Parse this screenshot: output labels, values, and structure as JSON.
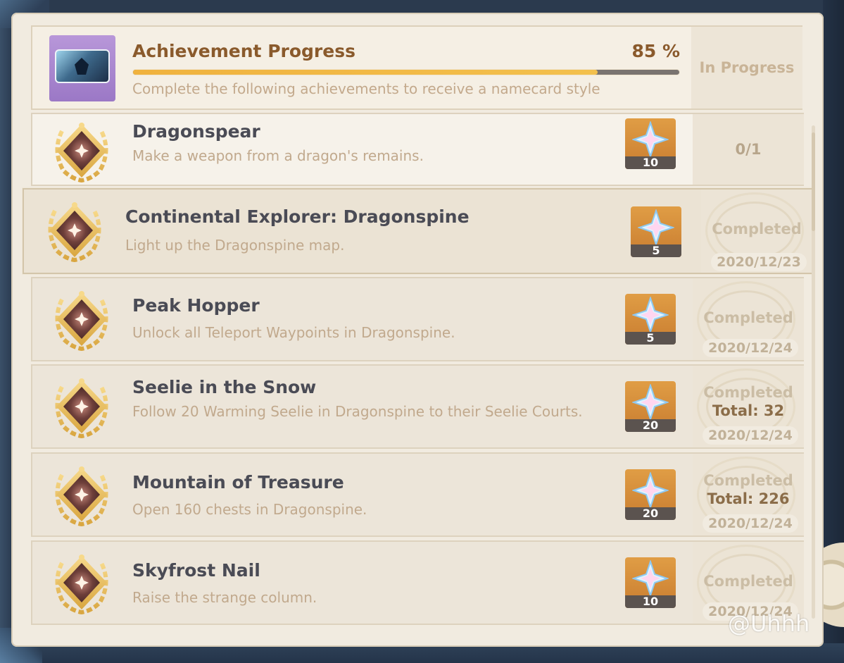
{
  "header": {
    "title": "Achievement Progress",
    "percent_label": "85 %",
    "progress": 0.85,
    "description": "Complete the following achievements to receive a namecard style",
    "status": "In Progress"
  },
  "achievements": [
    {
      "title": "Dragonspear",
      "description": "Make a weapon from a dragon's remains.",
      "reward": "10",
      "status": "0/1"
    },
    {
      "title": "Continental Explorer: Dragonspine",
      "description": "Light up the Dragonspine map.",
      "reward": "5",
      "status": "Completed",
      "date": "2020/12/23"
    },
    {
      "title": "Peak Hopper",
      "description": "Unlock all Teleport Waypoints in Dragonspine.",
      "reward": "5",
      "status": "Completed",
      "date": "2020/12/24"
    },
    {
      "title": "Seelie in the Snow",
      "description": "Follow 20 Warming Seelie in Dragonspine to their Seelie Courts.",
      "reward": "20",
      "status": "Completed",
      "total": "Total: 32",
      "date": "2020/12/24"
    },
    {
      "title": "Mountain of Treasure",
      "description": "Open 160 chests in Dragonspine.",
      "reward": "20",
      "status": "Completed",
      "total": "Total: 226",
      "date": "2020/12/24"
    },
    {
      "title": "Skyfrost Nail",
      "description": "Raise the strange column.",
      "reward": "10",
      "status": "Completed",
      "date": "2020/12/24"
    }
  ],
  "watermark": "@Uhhh",
  "icons": {
    "badge": "achievement-badge-icon",
    "reward": "primogem-icon",
    "namecard": "namecard-icon"
  },
  "colors": {
    "accent": "#8a5a2c",
    "progress": "#f0b23e",
    "reward_bg": "#d98e3b"
  }
}
